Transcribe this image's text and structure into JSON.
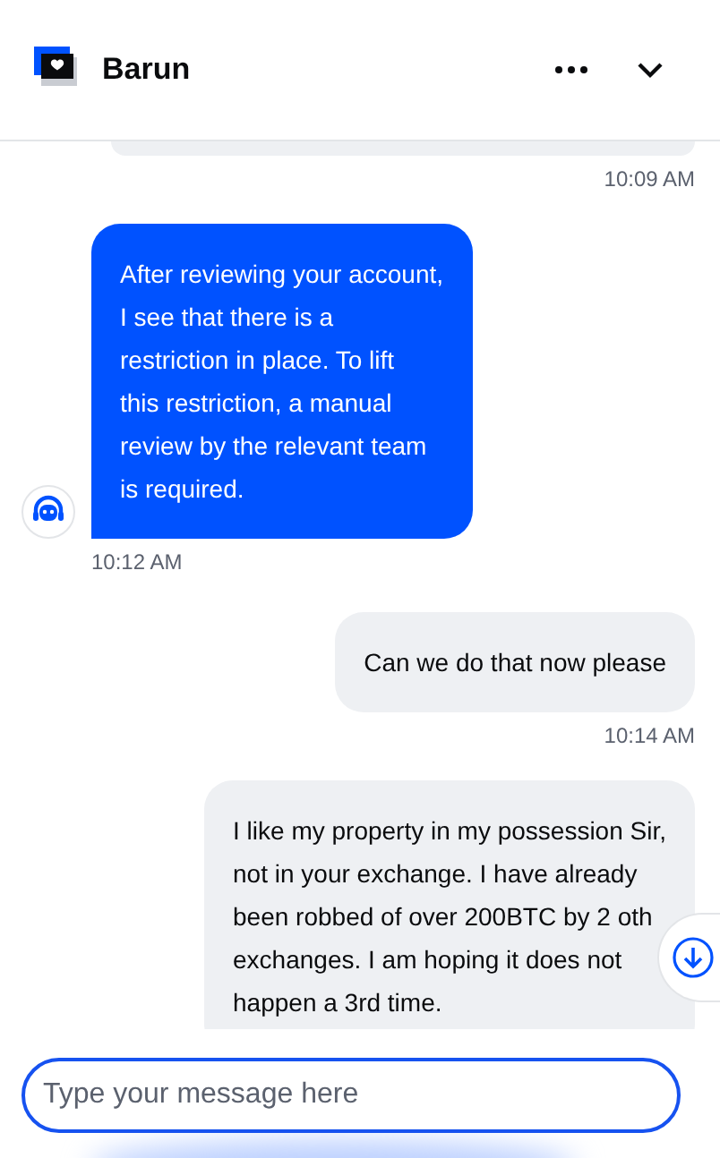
{
  "header": {
    "title": "Barun"
  },
  "messages": [
    {
      "kind": "user",
      "time": "10:09 AM"
    },
    {
      "kind": "agent",
      "lines": [
        "After reviewing your account,",
        "I see that there is a",
        "restriction in place. To lift",
        "this restriction, a manual",
        "review by the relevant team",
        "is required."
      ],
      "time": "10:12 AM"
    },
    {
      "kind": "user",
      "lines": [
        "Can we do that now please"
      ],
      "time": "10:14 AM"
    },
    {
      "kind": "user",
      "lines": [
        "I like my property in my possession Sir,",
        "not in your exchange. I have already",
        "been robbed of over 200BTC by 2 oth",
        "exchanges. I am hoping it does not",
        "happen a 3rd time."
      ]
    }
  ],
  "composer": {
    "placeholder": "Type your message here"
  }
}
